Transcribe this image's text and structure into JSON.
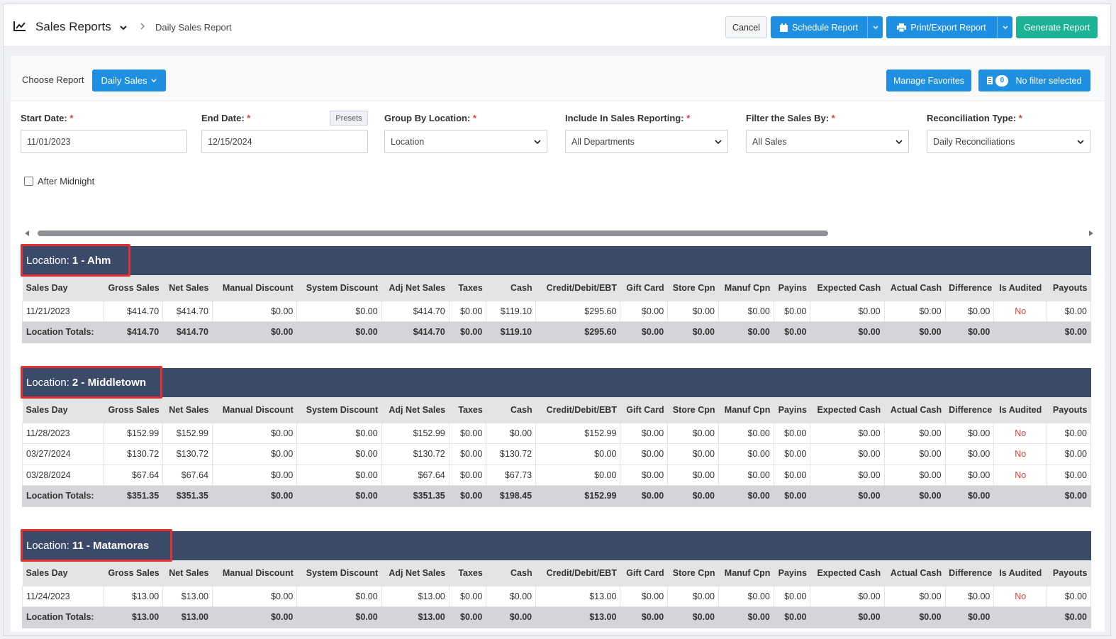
{
  "header": {
    "title": "Sales Reports",
    "breadcrumb": "Daily Sales Report",
    "cancel_label": "Cancel",
    "schedule_label": "Schedule Report",
    "print_label": "Print/Export Report",
    "generate_label": "Generate Report"
  },
  "report": {
    "choose_label": "Choose Report",
    "selected_report": "Daily Sales",
    "manage_favorites_label": "Manage Favorites",
    "filter_count": "0",
    "filter_status": "No filter selected"
  },
  "filters": {
    "start_date_label": "Start Date:",
    "start_date_value": "11/01/2023",
    "end_date_label": "End Date:",
    "end_date_value": "12/15/2024",
    "presets_label": "Presets",
    "group_by_label": "Group By Location:",
    "group_by_value": "Location",
    "include_label": "Include In Sales Reporting:",
    "include_value": "All Departments",
    "filter_by_label": "Filter the Sales By:",
    "filter_by_value": "All Sales",
    "recon_label": "Reconciliation Type:",
    "recon_value": "Daily Reconciliations",
    "required_mark": "*",
    "after_midnight_label": "After Midnight"
  },
  "columns": [
    "Sales Day",
    "Gross Sales",
    "Net Sales",
    "Manual Discount",
    "System Discount",
    "Adj Net Sales",
    "Taxes",
    "Cash",
    "Credit/Debit/EBT",
    "Gift Card",
    "Store Cpn",
    "Manuf Cpn",
    "Payins",
    "Expected Cash",
    "Actual Cash",
    "Difference",
    "Is Audited",
    "Payouts"
  ],
  "locations": [
    {
      "prefix": "Location:",
      "name": "1 - Ahm",
      "rows": [
        [
          "11/21/2023",
          "$414.70",
          "$414.70",
          "$0.00",
          "$0.00",
          "$414.70",
          "$0.00",
          "$119.10",
          "$295.60",
          "$0.00",
          "$0.00",
          "$0.00",
          "$0.00",
          "$0.00",
          "$0.00",
          "$0.00",
          "No",
          "$0.00"
        ]
      ],
      "totals": [
        "Location Totals:",
        "$414.70",
        "$414.70",
        "$0.00",
        "$0.00",
        "$414.70",
        "$0.00",
        "$119.10",
        "$295.60",
        "$0.00",
        "$0.00",
        "$0.00",
        "$0.00",
        "$0.00",
        "$0.00",
        "$0.00",
        "",
        "$0.00"
      ]
    },
    {
      "prefix": "Location:",
      "name": "2 - Middletown",
      "rows": [
        [
          "11/28/2023",
          "$152.99",
          "$152.99",
          "$0.00",
          "$0.00",
          "$152.99",
          "$0.00",
          "$0.00",
          "$152.99",
          "$0.00",
          "$0.00",
          "$0.00",
          "$0.00",
          "$0.00",
          "$0.00",
          "$0.00",
          "No",
          "$0.00"
        ],
        [
          "03/27/2024",
          "$130.72",
          "$130.72",
          "$0.00",
          "$0.00",
          "$130.72",
          "$0.00",
          "$130.72",
          "$0.00",
          "$0.00",
          "$0.00",
          "$0.00",
          "$0.00",
          "$0.00",
          "$0.00",
          "$0.00",
          "No",
          "$0.00"
        ],
        [
          "03/28/2024",
          "$67.64",
          "$67.64",
          "$0.00",
          "$0.00",
          "$67.64",
          "$0.00",
          "$67.73",
          "$0.00",
          "$0.00",
          "$0.00",
          "$0.00",
          "$0.00",
          "$0.00",
          "$0.00",
          "$0.00",
          "No",
          "$0.00"
        ]
      ],
      "totals": [
        "Location Totals:",
        "$351.35",
        "$351.35",
        "$0.00",
        "$0.00",
        "$351.35",
        "$0.00",
        "$198.45",
        "$152.99",
        "$0.00",
        "$0.00",
        "$0.00",
        "$0.00",
        "$0.00",
        "$0.00",
        "$0.00",
        "",
        "$0.00"
      ]
    },
    {
      "prefix": "Location:",
      "name": "11 - Matamoras",
      "rows": [
        [
          "11/24/2023",
          "$13.00",
          "$13.00",
          "$0.00",
          "$0.00",
          "$13.00",
          "$0.00",
          "$0.00",
          "$13.00",
          "$0.00",
          "$0.00",
          "$0.00",
          "$0.00",
          "$0.00",
          "$0.00",
          "$0.00",
          "No",
          "$0.00"
        ]
      ],
      "totals": [
        "Location Totals:",
        "$13.00",
        "$13.00",
        "$0.00",
        "$0.00",
        "$13.00",
        "$0.00",
        "$0.00",
        "$13.00",
        "$0.00",
        "$0.00",
        "$0.00",
        "$0.00",
        "$0.00",
        "$0.00",
        "$0.00",
        "",
        "$0.00"
      ]
    }
  ]
}
